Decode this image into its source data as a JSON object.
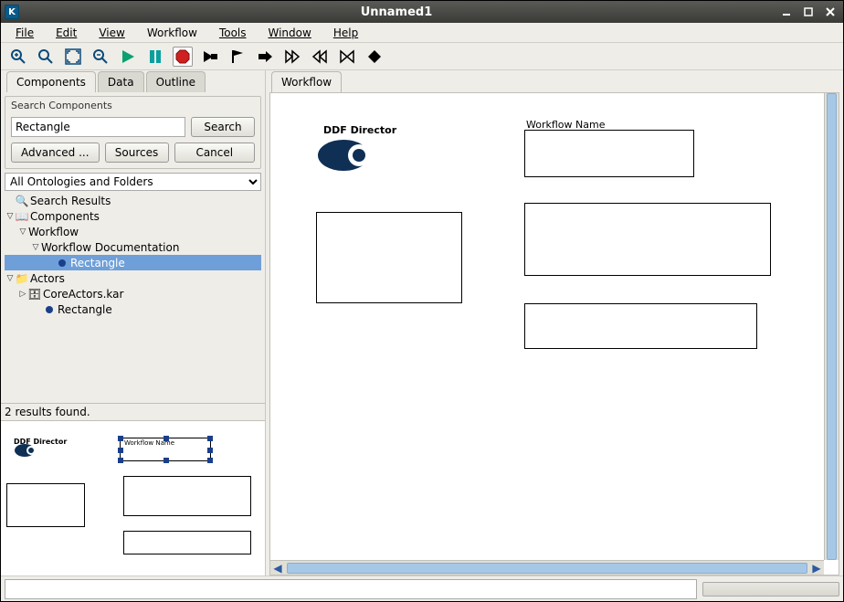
{
  "window": {
    "title": "Unnamed1",
    "app_icon_letter": "K"
  },
  "menu": {
    "file": "File",
    "edit": "Edit",
    "view": "View",
    "workflow": "Workflow",
    "tools": "Tools",
    "window_": "Window",
    "help": "Help"
  },
  "left_tabs": {
    "components": "Components",
    "data": "Data",
    "outline": "Outline"
  },
  "search_panel": {
    "title": "Search Components",
    "value": "Rectangle",
    "search_btn": "Search",
    "advanced_btn": "Advanced ...",
    "sources_btn": "Sources",
    "cancel_btn": "Cancel"
  },
  "ontology_select": "All Ontologies and Folders",
  "tree": {
    "search_results": "Search Results",
    "components": "Components",
    "workflow": "Workflow",
    "workflow_doc": "Workflow Documentation",
    "rectangle1": "Rectangle",
    "actors": "Actors",
    "core_actors": "CoreActors.kar",
    "rectangle2": "Rectangle"
  },
  "results_status": "2 results found.",
  "main_tab": "Workflow",
  "canvas": {
    "director_label": "DDF Director",
    "workflow_name_label": "Workflow Name"
  },
  "thumb": {
    "director_label": "DDF Director",
    "workflow_name_label": "Workflow Name"
  }
}
